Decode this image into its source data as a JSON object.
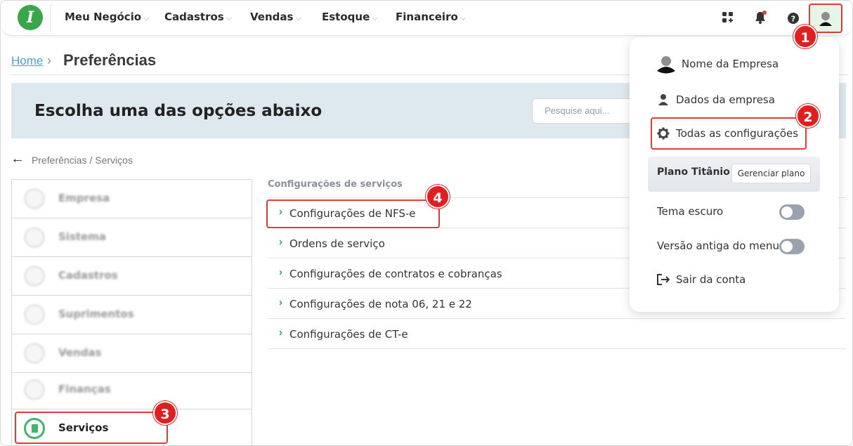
{
  "topbar": {
    "logo_text": "I",
    "menu": [
      {
        "label": "Meu Negócio"
      },
      {
        "label": "Cadastros"
      },
      {
        "label": "Vendas"
      },
      {
        "label": "Estoque"
      },
      {
        "label": "Financeiro"
      }
    ],
    "icons": [
      "apps-icon",
      "bell-icon",
      "help-icon",
      "user-avatar-icon"
    ]
  },
  "breadcrumb": {
    "home": "Home",
    "current": "Preferências"
  },
  "banner": {
    "title": "Escolha uma das opções abaixo",
    "search_placeholder": "Pesquise aqui..."
  },
  "back": {
    "label": "Preferências / Serviços"
  },
  "sidebar": {
    "items": [
      {
        "label": "Empresa"
      },
      {
        "label": "Sistema"
      },
      {
        "label": "Cadastros"
      },
      {
        "label": "Suprimentos"
      },
      {
        "label": "Vendas"
      },
      {
        "label": "Finanças"
      },
      {
        "label": "Serviços"
      }
    ]
  },
  "services": {
    "title": "Configurações de serviços",
    "items": [
      {
        "label": "Configurações de NFS-e"
      },
      {
        "label": "Ordens de serviço"
      },
      {
        "label": "Configurações de contratos e cobranças"
      },
      {
        "label": "Configurações de nota 06, 21 e 22"
      },
      {
        "label": "Configurações de CT-e"
      }
    ]
  },
  "dropdown": {
    "company_name": "Nome da Empresa",
    "company_data": "Dados da empresa",
    "all_settings": "Todas as configurações",
    "plan_label": "Plano Titânio",
    "plan_button": "Gerenciar plano",
    "dark_theme": "Tema escuro",
    "old_menu": "Versão antiga do menu",
    "logout": "Sair da conta"
  },
  "markers": [
    "1",
    "2",
    "3",
    "4"
  ],
  "colors": {
    "accent": "#3aa64a",
    "marker": "#e02020",
    "banner_bg": "#dde9ef",
    "link": "#4aa3c8"
  }
}
